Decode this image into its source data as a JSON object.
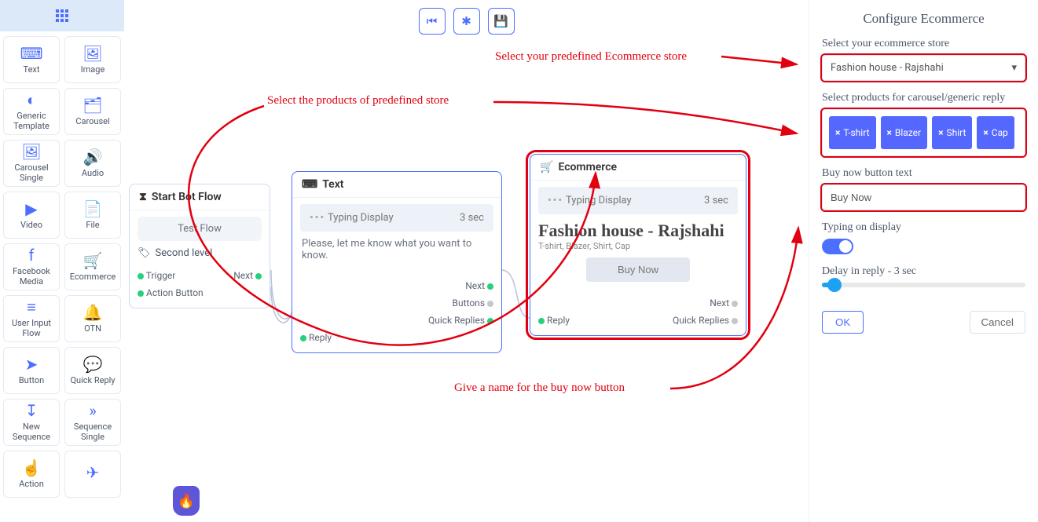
{
  "sidebar": {
    "items": [
      {
        "label": "Text",
        "icon": "⌨"
      },
      {
        "label": "Image",
        "icon": "🖼"
      },
      {
        "label": "Generic Template",
        "icon": "◐"
      },
      {
        "label": "Carousel",
        "icon": "🗂"
      },
      {
        "label": "Carousel Single",
        "icon": "🖼"
      },
      {
        "label": "Audio",
        "icon": "🔊"
      },
      {
        "label": "Video",
        "icon": "▶"
      },
      {
        "label": "File",
        "icon": "📄"
      },
      {
        "label": "Facebook Media",
        "icon": "f"
      },
      {
        "label": "Ecommerce",
        "icon": "🛒"
      },
      {
        "label": "User Input Flow",
        "icon": "≡"
      },
      {
        "label": "OTN",
        "icon": "🔔"
      },
      {
        "label": "Button",
        "icon": "➤"
      },
      {
        "label": "Quick Reply",
        "icon": "💬"
      },
      {
        "label": "New Sequence",
        "icon": "↧"
      },
      {
        "label": "Sequence Single",
        "icon": "»"
      },
      {
        "label": "Action",
        "icon": "☝"
      },
      {
        "label": "",
        "icon": "✈"
      }
    ]
  },
  "toolbar": {
    "reset": "⏮",
    "center": "✱",
    "save": "💾"
  },
  "nodes": {
    "start": {
      "title": "Start Bot Flow",
      "test_flow": "Test Flow",
      "tag_label": "Second level",
      "ports": {
        "trigger": "Trigger",
        "action_button": "Action Button",
        "next": "Next"
      }
    },
    "text": {
      "title": "Text",
      "typing_label": "Typing Display",
      "typing_value": "3 sec",
      "content": "Please, let me know what you want to know.",
      "ports": {
        "reply": "Reply",
        "next": "Next",
        "buttons": "Buttons",
        "quick_replies": "Quick Replies"
      }
    },
    "ecommerce": {
      "title": "Ecommerce",
      "typing_label": "Typing Display",
      "typing_value": "3 sec",
      "store_title": "Fashion house - Rajshahi",
      "store_sub": "T-shirt, Blazer, Shirt, Cap",
      "buy_now": "Buy Now",
      "ports": {
        "reply": "Reply",
        "next": "Next",
        "quick_replies": "Quick Replies"
      }
    }
  },
  "annotations": {
    "store": "Select your predefined Ecommerce store",
    "products": "Select the products of predefined store",
    "buy_name": "Give a name for the buy now button"
  },
  "panel": {
    "title": "Configure Ecommerce",
    "store_label": "Select your ecommerce store",
    "store_value": "Fashion house - Rajshahi",
    "products_label": "Select products for carousel/generic reply",
    "products": [
      "T-shirt",
      "Blazer",
      "Shirt",
      "Cap"
    ],
    "buy_label": "Buy now button text",
    "buy_value": "Buy Now",
    "typing_label": "Typing on display",
    "typing_on": true,
    "delay_label": "Delay in reply  -  3 sec",
    "ok": "OK",
    "cancel": "Cancel"
  }
}
